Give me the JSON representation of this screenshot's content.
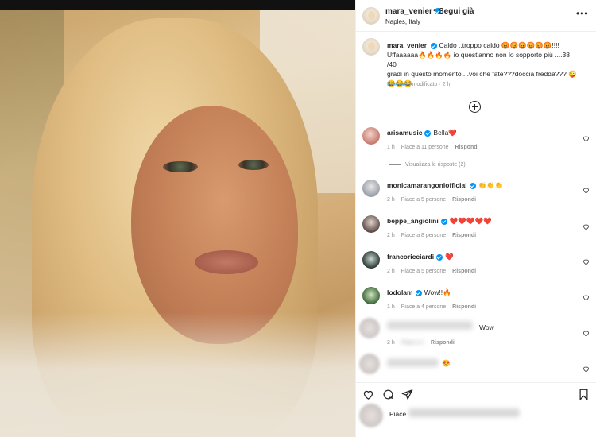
{
  "post": {
    "author": "mara_venier",
    "separator": "•",
    "follow_label": "Segui già",
    "location": "Naples, Italy",
    "more_label": "•••"
  },
  "caption": {
    "author": "mara_venier",
    "line1": "Caldo ..troppo caldo 😡😡😡😡😡😡!!!!",
    "line2": "Uffaaaaaa🔥🔥🔥🔥 io quest'anno non lo sopporto più ....38 /40",
    "line3": "gradi in questo momento....voi che fate???doccia fredda??? 😜",
    "line4": "😂😂😂",
    "meta": "Elemento modificato · 2 h"
  },
  "comments": [
    {
      "user": "arisamusic",
      "text": "Bella❤️",
      "time": "1 h",
      "likes": "Piace a 11 persone",
      "reply": "Rispondi"
    },
    {
      "user": "monicamarangoniofficial",
      "text": "👏👏👏",
      "time": "2 h",
      "likes": "Piace a 5 persone",
      "reply": "Rispondi"
    },
    {
      "user": "beppe_angiolini",
      "text": "❤️❤️❤️❤️❤️",
      "time": "2 h",
      "likes": "Piace a 8 persone",
      "reply": "Rispondi"
    },
    {
      "user": "francoricciardi",
      "text": "❤️",
      "time": "2 h",
      "likes": "Piace a 5 persone",
      "reply": "Rispondi"
    },
    {
      "user": "lodolam",
      "text": "Wow!!🔥",
      "time": "1 h",
      "likes": "Piace a 4 persone",
      "reply": "Rispondi"
    },
    {
      "user": "",
      "text": "Wow",
      "time": "2 h",
      "likes": "Piace a 1",
      "reply": "Rispondi"
    },
    {
      "user": "",
      "text": "😍",
      "time": "",
      "likes": "",
      "reply": ""
    }
  ],
  "view_replies": "Visualizza le risposte (2)",
  "likes_prefix": "Piace",
  "colors": {
    "verified": "#0095f6",
    "muted": "#8e8e8e",
    "text": "#262626"
  }
}
